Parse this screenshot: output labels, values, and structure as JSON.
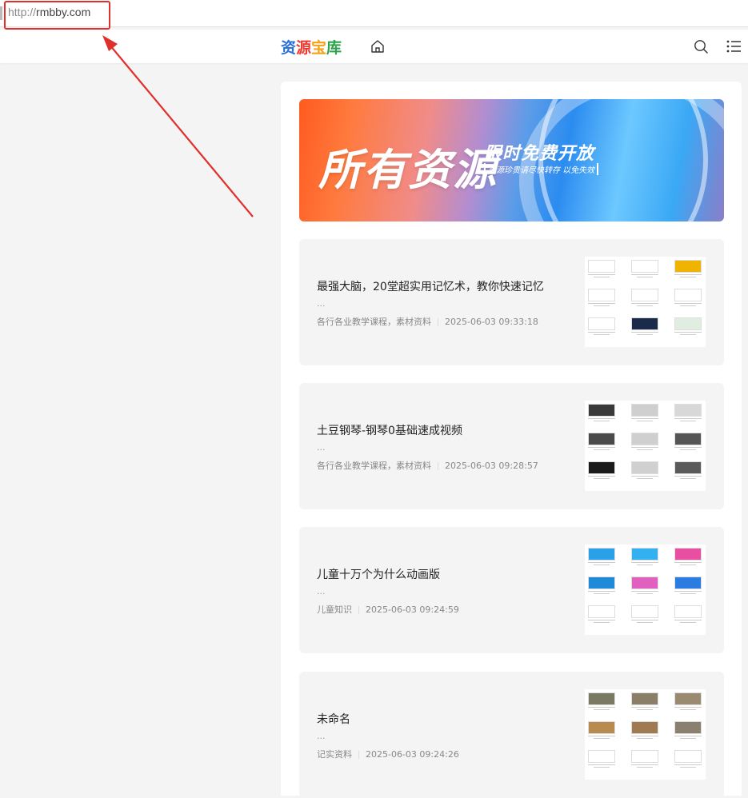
{
  "browser": {
    "url_protocol": "http://",
    "url_host": "rmbby.com"
  },
  "header": {
    "logo_chars": [
      "资",
      "源",
      "宝",
      "库"
    ],
    "logo_colors": [
      "#2a6fd6",
      "#ef3a2f",
      "#f3a21a",
      "#2aa34a"
    ],
    "icons": [
      "home-icon",
      "search-icon",
      "menu-list-icon"
    ]
  },
  "banner": {
    "headline": "所有资源",
    "tagline": "限时免费开放",
    "subtag": "资源珍贵请尽快转存 以免失效"
  },
  "posts": [
    {
      "title": "最强大脑，20堂超实用记忆术，教你快速记忆",
      "excerpt": "...",
      "category": "各行各业教学课程，素材资料",
      "date": "2025-06-03 09:33:18",
      "thumb_style": "slides"
    },
    {
      "title": "土豆钢琴-钢琴0基础速成视频",
      "excerpt": "...",
      "category": "各行各业教学课程，素材资料",
      "date": "2025-06-03 09:28:57",
      "thumb_style": "piano"
    },
    {
      "title": "儿童十万个为什么动画版",
      "excerpt": "...",
      "category": "儿童知识",
      "date": "2025-06-03 09:24:59",
      "thumb_style": "cartoon"
    },
    {
      "title": "未命名",
      "excerpt": "...",
      "category": "记实资料",
      "date": "2025-06-03 09:24:26",
      "thumb_style": "documentary"
    }
  ],
  "colors": {
    "annotation_red": "#e0302b",
    "card_bg": "#f4f4f5",
    "page_bg": "#f4f4f4"
  }
}
